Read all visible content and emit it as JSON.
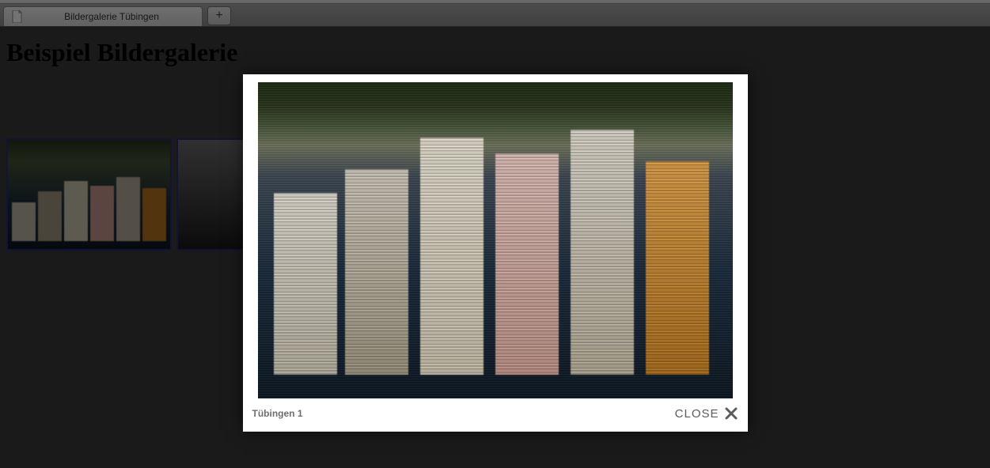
{
  "browser": {
    "tab_title": "Bildergalerie Tübingen",
    "new_tab_label": "+"
  },
  "page": {
    "heading": "Beispiel Bildergalerie"
  },
  "lightbox": {
    "caption": "Tübingen 1",
    "close_label": "CLOSE"
  }
}
